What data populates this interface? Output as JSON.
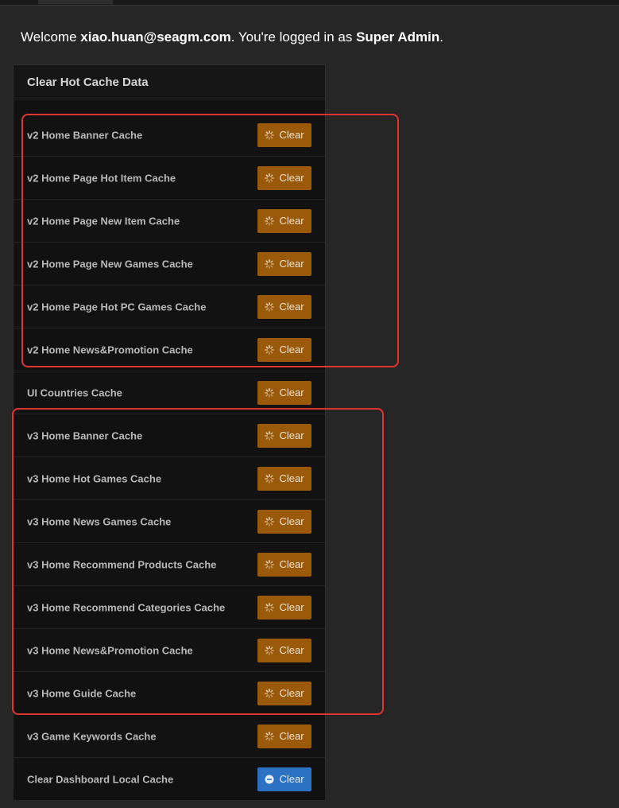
{
  "welcome": {
    "prefix": "Welcome ",
    "email": "xiao.huan@seagm.com",
    "middle": ". You're logged in as ",
    "role": "Super Admin",
    "suffix": "."
  },
  "panel": {
    "title": "Clear Hot Cache Data",
    "rows": [
      {
        "label": "v2 Home Banner Cache",
        "button": "Clear",
        "button_icon": "spinner-icon"
      },
      {
        "label": "v2 Home Page Hot Item Cache",
        "button": "Clear",
        "button_icon": "spinner-icon"
      },
      {
        "label": "v2 Home Page New Item Cache",
        "button": "Clear",
        "button_icon": "spinner-icon"
      },
      {
        "label": "v2 Home Page New Games Cache",
        "button": "Clear",
        "button_icon": "spinner-icon"
      },
      {
        "label": "v2 Home Page Hot PC Games Cache",
        "button": "Clear",
        "button_icon": "spinner-icon"
      },
      {
        "label": "v2 Home News&Promotion Cache",
        "button": "Clear",
        "button_icon": "spinner-icon"
      },
      {
        "label": "UI Countries Cache",
        "button": "Clear",
        "button_icon": "spinner-icon"
      },
      {
        "label": "v3 Home Banner Cache",
        "button": "Clear",
        "button_icon": "spinner-icon"
      },
      {
        "label": "v3 Home Hot Games Cache",
        "button": "Clear",
        "button_icon": "spinner-icon"
      },
      {
        "label": "v3 Home News Games Cache",
        "button": "Clear",
        "button_icon": "spinner-icon"
      },
      {
        "label": "v3 Home Recommend Products Cache",
        "button": "Clear",
        "button_icon": "spinner-icon"
      },
      {
        "label": "v3 Home Recommend Categories Cache",
        "button": "Clear",
        "button_icon": "spinner-icon"
      },
      {
        "label": "v3 Home News&Promotion Cache",
        "button": "Clear",
        "button_icon": "spinner-icon"
      },
      {
        "label": "v3 Home Guide Cache",
        "button": "Clear",
        "button_icon": "spinner-icon"
      },
      {
        "label": "v3 Game Keywords Cache",
        "button": "Clear",
        "button_icon": "spinner-icon"
      },
      {
        "label": "Clear Dashboard Local Cache",
        "button": "Clear",
        "button_icon": "minus-circle-icon"
      }
    ]
  },
  "colors": {
    "clear_button": "#9a5a0a",
    "dashboard_button": "#2b72c2",
    "highlight_border": "#e0352f"
  }
}
